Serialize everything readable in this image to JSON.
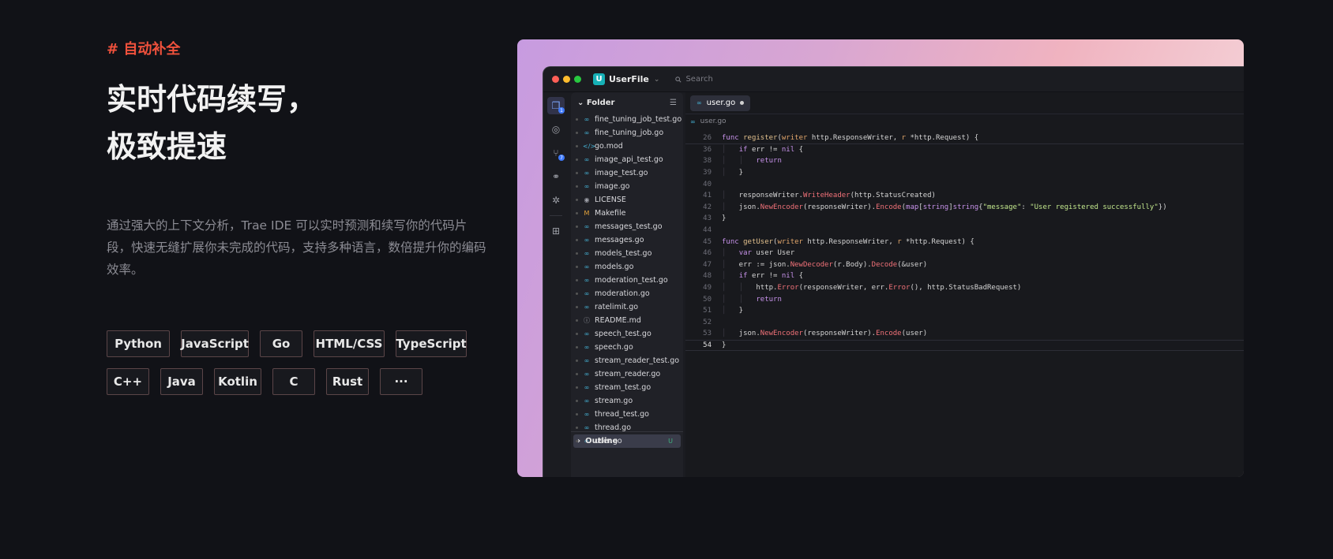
{
  "tag": "# 自动补全",
  "headline": [
    "实时代码续写，",
    "极致提速"
  ],
  "description": "通过强大的上下文分析，Trae IDE 可以实时预测和续写你的代码片段，快速无缝扩展你未完成的代码，支持多种语言，数倍提升你的编码效率。",
  "languages": [
    [
      "Python",
      "JavaScript",
      "Go",
      "HTML/CSS",
      "TypeScript"
    ],
    [
      "C++",
      "Java",
      "Kotlin",
      "C",
      "Rust",
      "···"
    ]
  ],
  "ide": {
    "project_badge": "U",
    "project_name": "UserFile",
    "search_placeholder": "Search",
    "explorer_title": "Folder",
    "outline_label": "Outline",
    "files": [
      {
        "name": "fine_tuning_job_test.go",
        "icon": "go"
      },
      {
        "name": "fine_tuning_job.go",
        "icon": "go"
      },
      {
        "name": "go.mod",
        "icon": "code"
      },
      {
        "name": "image_api_test.go",
        "icon": "go"
      },
      {
        "name": "image_test.go",
        "icon": "go"
      },
      {
        "name": "image.go",
        "icon": "go"
      },
      {
        "name": "LICENSE",
        "icon": "license"
      },
      {
        "name": "Makefile",
        "icon": "makefile"
      },
      {
        "name": "messages_test.go",
        "icon": "go"
      },
      {
        "name": "messages.go",
        "icon": "go"
      },
      {
        "name": "models_test.go",
        "icon": "go"
      },
      {
        "name": "models.go",
        "icon": "go"
      },
      {
        "name": "moderation_test.go",
        "icon": "go"
      },
      {
        "name": "moderation.go",
        "icon": "go"
      },
      {
        "name": "ratelimit.go",
        "icon": "go"
      },
      {
        "name": "README.md",
        "icon": "info"
      },
      {
        "name": "speech_test.go",
        "icon": "go"
      },
      {
        "name": "speech.go",
        "icon": "go"
      },
      {
        "name": "stream_reader_test.go",
        "icon": "go"
      },
      {
        "name": "stream_reader.go",
        "icon": "go"
      },
      {
        "name": "stream_test.go",
        "icon": "go"
      },
      {
        "name": "stream.go",
        "icon": "go"
      },
      {
        "name": "thread_test.go",
        "icon": "go"
      },
      {
        "name": "thread.go",
        "icon": "go"
      },
      {
        "name": "user.go",
        "icon": "go",
        "selected": true,
        "git": "U"
      }
    ],
    "tab_label": "user.go",
    "breadcrumb": "user.go",
    "code_lines": [
      {
        "n": "26",
        "t": "func register(writer http.ResponseWriter, r *http.Request) {"
      },
      {
        "n": "36",
        "t": "    if err != nil {"
      },
      {
        "n": "38",
        "t": "        return"
      },
      {
        "n": "39",
        "t": "    }"
      },
      {
        "n": "40",
        "t": ""
      },
      {
        "n": "41",
        "t": "    responseWriter.WriteHeader(http.StatusCreated)"
      },
      {
        "n": "42",
        "t": "    json.NewEncoder(responseWriter).Encode(map[string]string{\"message\": \"User registered successfully\"})"
      },
      {
        "n": "43",
        "t": "}"
      },
      {
        "n": "44",
        "t": ""
      },
      {
        "n": "45",
        "t": "func getUser(writer http.ResponseWriter, r *http.Request) {"
      },
      {
        "n": "46",
        "t": "    var user User"
      },
      {
        "n": "47",
        "t": "    err := json.NewDecoder(r.Body).Decode(&user)"
      },
      {
        "n": "48",
        "t": "    if err != nil {"
      },
      {
        "n": "49",
        "t": "        http.Error(responseWriter, err.Error(), http.StatusBadRequest)"
      },
      {
        "n": "50",
        "t": "        return"
      },
      {
        "n": "51",
        "t": "    }"
      },
      {
        "n": "52",
        "t": ""
      },
      {
        "n": "53",
        "t": "    json.NewEncoder(responseWriter).Encode(user)"
      },
      {
        "n": "54",
        "t": "}"
      }
    ],
    "current_line": "54",
    "colors": {
      "accent": "#f0513c",
      "chip_border": "#5b4548",
      "teal_badge": "#16b0b6",
      "go_icon": "#46b3d6"
    }
  }
}
